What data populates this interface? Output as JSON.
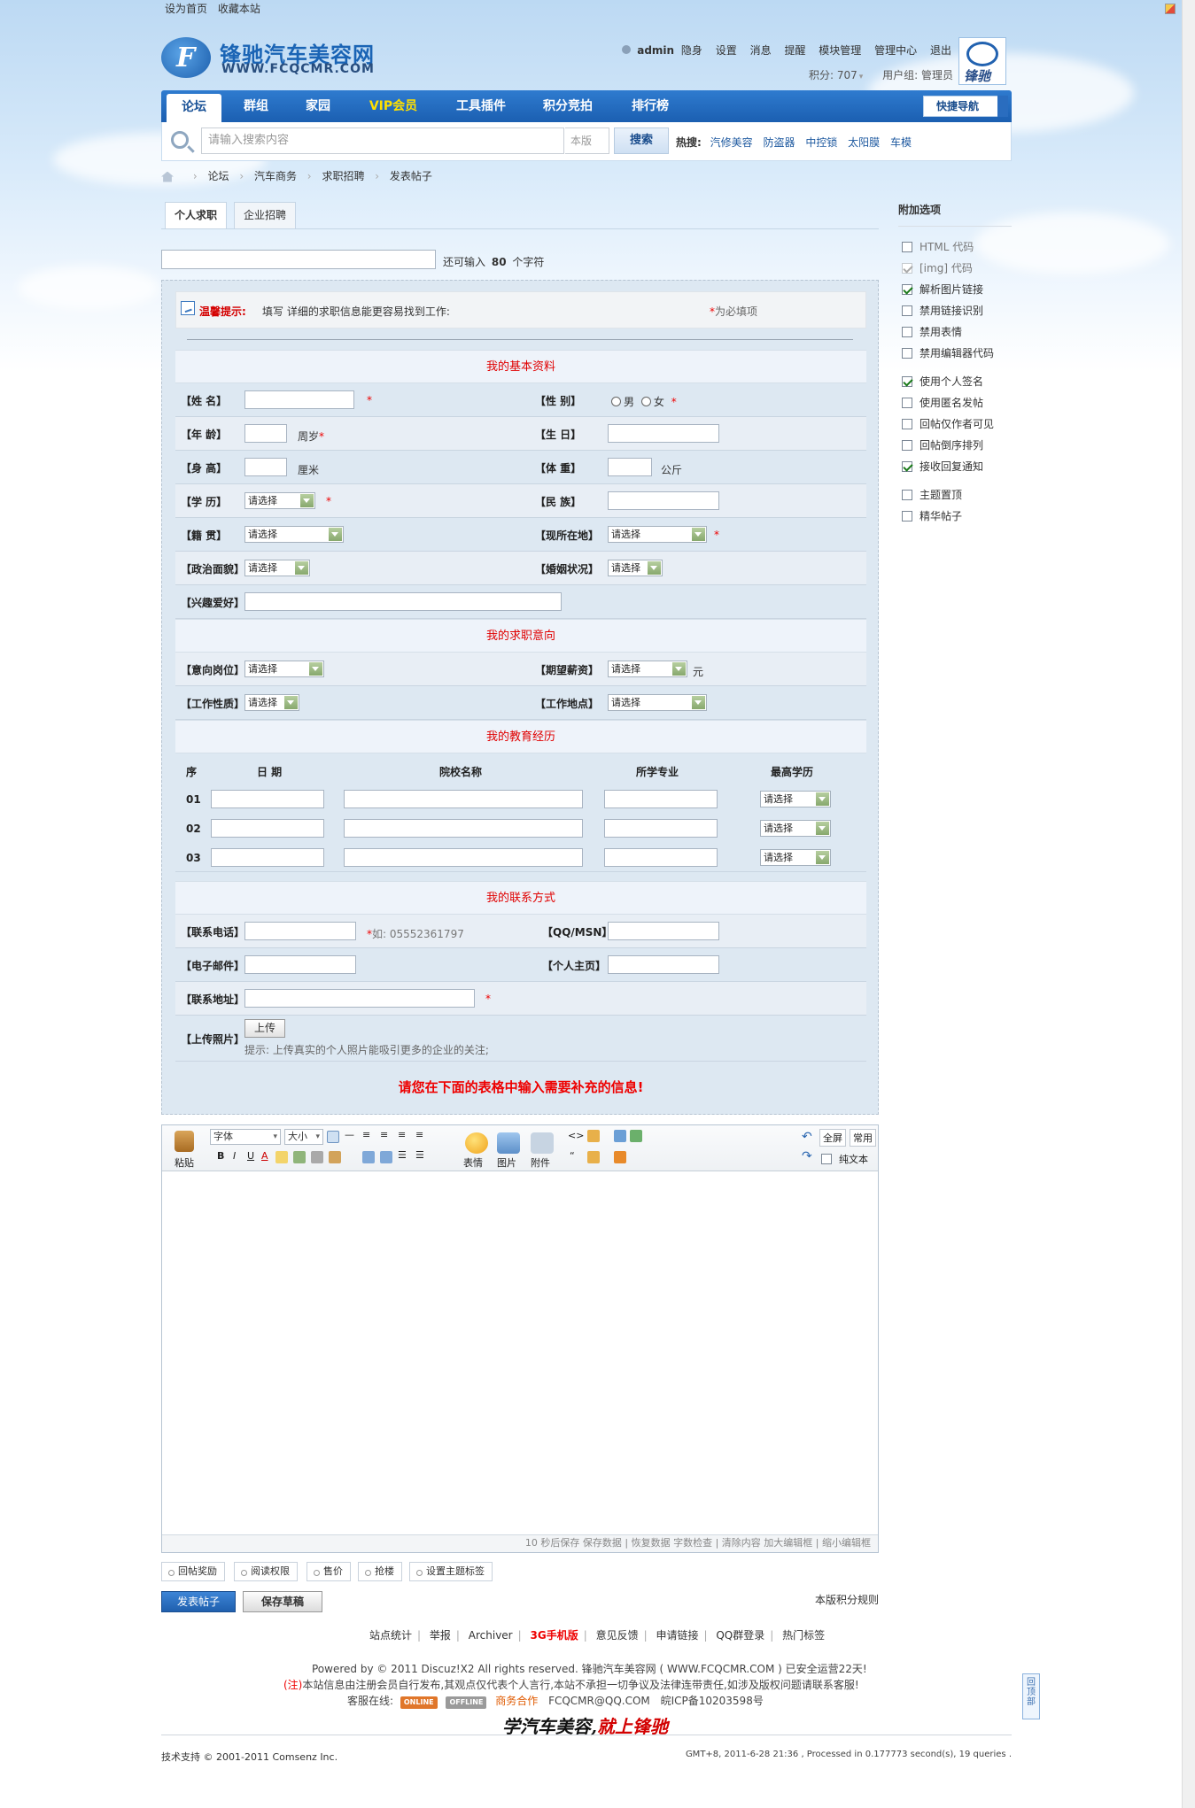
{
  "topbar": {
    "set_home": "设为首页",
    "bookmark": "收藏本站"
  },
  "logo": {
    "cn": "锋驰汽车美容网",
    "en": "WWW.FCQCMR.COM"
  },
  "userbar": {
    "username": "admin",
    "status": "隐身",
    "items": [
      "设置",
      "消息",
      "提醒",
      "模块管理",
      "管理中心",
      "退出"
    ]
  },
  "userinfo": {
    "points": "积分: 707",
    "group": "用户组: 管理员"
  },
  "brand_badge": "锋驰",
  "nav": {
    "items": [
      "论坛",
      "群组",
      "家园",
      "VIP会员",
      "工具插件",
      "积分竞拍",
      "排行榜"
    ],
    "quick": "快捷导航"
  },
  "search": {
    "placeholder": "请输入搜索内容",
    "scope": "本版",
    "button": "搜索",
    "hot_label": "热搜:",
    "hot": [
      "汽修美容",
      "防盗器",
      "中控锁",
      "太阳膜",
      "车模"
    ]
  },
  "breadcrumb": [
    "论坛",
    "汽车商务",
    "求职招聘",
    "发表帖子"
  ],
  "tabs": [
    "个人求职",
    "企业招聘"
  ],
  "subject": {
    "hint_pre": "还可输入",
    "remaining": "80",
    "hint_post": "个字符"
  },
  "tips": {
    "title": "温馨提示:",
    "text": "填写  详细的求职信息能更容易找到工作:",
    "required": "为必填项",
    "required_star": "*"
  },
  "sections": {
    "basic": "我的基本资料",
    "intent": "我的求职意向",
    "edu": "我的教育经历",
    "contact": "我的联系方式"
  },
  "labels": {
    "name": "【姓  名】",
    "gender": "【性  别】",
    "age": "【年  龄】",
    "birthday": "【生  日】",
    "height": "【身  高】",
    "weight": "【体  重】",
    "education": "【学  历】",
    "ethnic": "【民  族】",
    "native": "【籍  贯】",
    "location": "【现所在地】",
    "politics": "【政治面貌】",
    "marriage": "【婚姻状况】",
    "hobby": "【兴趣爱好】",
    "position": "【意向岗位】",
    "salary": "【期望薪资】",
    "jobtype": "【工作性质】",
    "workplace": "【工作地点】",
    "phone": "【联系电话】",
    "qq": "【QQ/MSN】",
    "email": "【电子邮件】",
    "homepage": "【个人主页】",
    "address": "【联系地址】",
    "photo": "【上传照片】"
  },
  "units": {
    "age": "周岁",
    "height": "厘米",
    "weight": "公斤",
    "salary": "元"
  },
  "gender_opts": [
    "男",
    "女"
  ],
  "select_default": "请选择",
  "edu": {
    "headers": [
      "序",
      "日  期",
      "院校名称",
      "所学专业",
      "最高学历"
    ],
    "rows": [
      "01",
      "02",
      "03"
    ]
  },
  "phone_hint": "如: 05552361797",
  "upload": {
    "button": "上传",
    "hint": "提示: 上传真实的个人照片能吸引更多的企业的关注;"
  },
  "notice": "请您在下面的表格中输入需要补充的信息!",
  "editor": {
    "paste": "粘贴",
    "font": "字体",
    "size": "大小",
    "emoticon": "表情",
    "image": "图片",
    "attach": "附件",
    "fullscreen": "全屏",
    "common": "常用",
    "plain": "纯文本",
    "footer": "10 秒后保存  保存数据  |  恢复数据    字数检查  |  清除内容    加大编辑框  |  缩小编辑框"
  },
  "extras": [
    "回帖奖励",
    "阅读权限",
    "售价",
    "抢楼",
    "设置主题标签"
  ],
  "buttons": {
    "post": "发表帖子",
    "draft": "保存草稿",
    "rules": "本版积分规则"
  },
  "sidebar": {
    "title": "附加选项",
    "options": [
      {
        "label": "HTML 代码",
        "checked": false,
        "disabled": false
      },
      {
        "label": "[img] 代码",
        "checked": true,
        "disabled": true
      },
      {
        "label": "解析图片链接",
        "checked": true,
        "disabled": false
      },
      {
        "label": "禁用链接识别",
        "checked": false,
        "disabled": false
      },
      {
        "label": "禁用表情",
        "checked": false,
        "disabled": false
      },
      {
        "label": "禁用编辑器代码",
        "checked": false,
        "disabled": false
      },
      {
        "label": "使用个人签名",
        "checked": true,
        "disabled": false
      },
      {
        "label": "使用匿名发帖",
        "checked": false,
        "disabled": false
      },
      {
        "label": "回帖仅作者可见",
        "checked": false,
        "disabled": false
      },
      {
        "label": "回帖倒序排列",
        "checked": false,
        "disabled": false
      },
      {
        "label": "接收回复通知",
        "checked": true,
        "disabled": false
      },
      {
        "label": "主题置顶",
        "checked": false,
        "disabled": false
      },
      {
        "label": "精华帖子",
        "checked": false,
        "disabled": false
      }
    ]
  },
  "footer": {
    "links": [
      "站点统计",
      "举报",
      "Archiver",
      "3G手机版",
      "意见反馈",
      "申请链接",
      "QQ群登录",
      "热门标签"
    ],
    "powered": "Powered by © 2011 Discuz!X2 All rights reserved.   锋驰汽车美容网 ( WWW.FCQCMR.COM ) 已安全运营22天!",
    "notice_mark": "(注)",
    "notice": "本站信息由注册会员自行发布,其观点仅代表个人言行,本站不承担一切争议及法律连带责任,如涉及版权问题请联系客服!",
    "service_label": "客服在线:",
    "online": "ONLINE",
    "offline": "OFFLINE",
    "biz": "商务合作",
    "email": "FCQCMR@QQ.COM",
    "icp": "皖ICP备10203598号",
    "slogan_a": "学汽车美容,",
    "slogan_b": "就上锋驰",
    "copyright": "技术支持 © 2001-2011 Comsenz Inc.",
    "gmt": "GMT+8, 2011-6-28 21:36 , Processed in 0.177773 second(s), 19 queries ."
  },
  "backtop": "回顶部"
}
